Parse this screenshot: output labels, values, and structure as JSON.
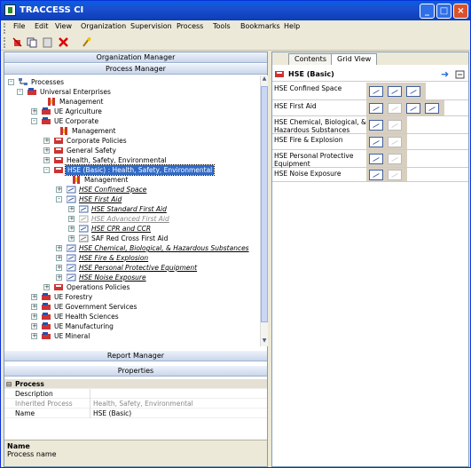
{
  "window": {
    "title": "TRACCESS CI"
  },
  "menu": [
    "File",
    "Edit",
    "View",
    "Organization",
    "Supervision",
    "Process",
    "Tools",
    "Bookmarks",
    "Help"
  ],
  "left": {
    "org_header": "Organization Manager",
    "proc_header": "Process Manager",
    "report_header": "Report Manager",
    "props_header": "Properties"
  },
  "tree": [
    {
      "label": "Processes"
    },
    {
      "label": "Universal Enterprises"
    },
    {
      "label": "Management"
    },
    {
      "label": "UE Agriculture"
    },
    {
      "label": "UE Corporate"
    },
    {
      "label": "Management"
    },
    {
      "label": "Corporate Policies"
    },
    {
      "label": "General Safety"
    },
    {
      "label": "Health, Safety, Environmental"
    },
    {
      "label": "HSE (Basic) : Health, Safety, Environmental"
    },
    {
      "label": "Management"
    },
    {
      "label": "HSE  Confined Space"
    },
    {
      "label": "HSE  First Aid"
    },
    {
      "label": "HSE  Standard First Aid"
    },
    {
      "label": "HSE  Advanced First Aid"
    },
    {
      "label": "HSE  CPR and CCR"
    },
    {
      "label": "SAF  Red Cross First Aid"
    },
    {
      "label": "HSE  Chemical, Biological, & Hazardous Substances"
    },
    {
      "label": "HSE  Fire & Explosion"
    },
    {
      "label": "HSE  Personal Protective Equipment"
    },
    {
      "label": "HSE  Noise Exposure"
    },
    {
      "label": "Operations Policies"
    },
    {
      "label": "UE Forestry"
    },
    {
      "label": "UE Government Services"
    },
    {
      "label": "UE Health Sciences"
    },
    {
      "label": "UE Manufacturing"
    },
    {
      "label": "UE Mineral"
    }
  ],
  "properties": {
    "section": "Process",
    "rows": [
      {
        "key": "Description",
        "value": ""
      },
      {
        "key": "Inherited Process",
        "value": "Health, Safety, Environmental"
      },
      {
        "key": "Name",
        "value": "HSE (Basic)"
      }
    ],
    "desc_title": "Name",
    "desc_text": "Process name"
  },
  "right": {
    "tabs": [
      "Contents",
      "Grid View"
    ],
    "active_tab": "Grid View",
    "grid_title": "HSE (Basic)",
    "rows": [
      {
        "name": "HSE  Confined Space",
        "icons": 3,
        "dim": 0
      },
      {
        "name": "HSE  First Aid",
        "icons": 4,
        "dim": 1
      },
      {
        "name": "HSE  Chemical, Biological, & Hazardous Substances",
        "icons": 2,
        "dim": 1
      },
      {
        "name": "HSE  Fire & Explosion",
        "icons": 2,
        "dim": 1
      },
      {
        "name": "HSE  Personal Protective Equipment",
        "icons": 2,
        "dim": 1
      },
      {
        "name": "HSE  Noise Exposure",
        "icons": 2,
        "dim": 1
      }
    ]
  }
}
